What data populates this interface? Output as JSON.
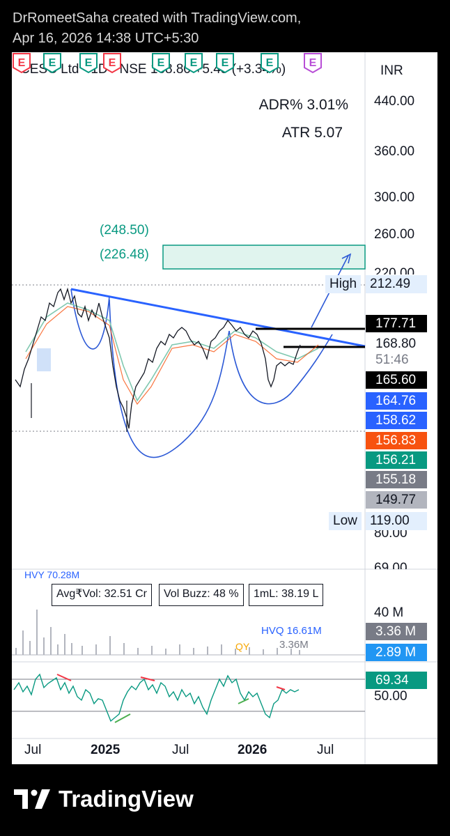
{
  "header": {
    "line1": "DrRomeetSaha created with TradingView.com,",
    "line2": "Apr 16, 2026 14:38 UTC+5:30"
  },
  "chart": {
    "title": "CESC Ltd · 1D · NSE  168.80  +5.45 (+3.34%)",
    "adr": "ADR%  3.01%",
    "atr": "ATR     5.07",
    "target_high": "(248.50)",
    "target_low": "(226.48)",
    "currency": "INR",
    "high_label": "High",
    "high_value": "212.49",
    "low_label": "Low",
    "low_value": "119.00",
    "countdown": "51:46",
    "price_axis": [
      "440.00",
      "360.00",
      "300.00",
      "260.00",
      "220.00",
      "80.00",
      "69.00"
    ],
    "price_tags": [
      {
        "value": "177.71",
        "bg": "#000000",
        "fg": "#ffffff"
      },
      {
        "value": "168.80",
        "bg": "#ffffff",
        "fg": "#131722"
      },
      {
        "value": "165.60",
        "bg": "#000000",
        "fg": "#ffffff"
      },
      {
        "value": "164.76",
        "bg": "#2962ff",
        "fg": "#ffffff"
      },
      {
        "value": "158.62",
        "bg": "#2962ff",
        "fg": "#ffffff"
      },
      {
        "value": "156.83",
        "bg": "#f7520f",
        "fg": "#ffffff"
      },
      {
        "value": "156.21",
        "bg": "#089981",
        "fg": "#ffffff"
      },
      {
        "value": "155.18",
        "bg": "#787b86",
        "fg": "#ffffff"
      },
      {
        "value": "149.77",
        "bg": "#b2b5be",
        "fg": "#131722"
      }
    ],
    "volume": {
      "hvy": "HVY 70.28M",
      "avg_vol": "Avg₹Vol: 32.51 Cr",
      "vol_buzz": "Vol Buzz: 48 %",
      "one_ml": "1mL: 38.19 L",
      "hvq": "HVQ 16.61M",
      "qy": "QY",
      "current": "3.36M",
      "axis_40m": "40 M",
      "tag_vol": "3.36 M",
      "tag_ma": "2.89 M"
    },
    "rsi": {
      "value": "69.34",
      "axis50": "50.00"
    },
    "time_axis": [
      "Jul",
      "2025",
      "Jul",
      "2026",
      "Jul"
    ],
    "earnings_badge": "E"
  },
  "footer": {
    "brand": "TradingView"
  }
}
